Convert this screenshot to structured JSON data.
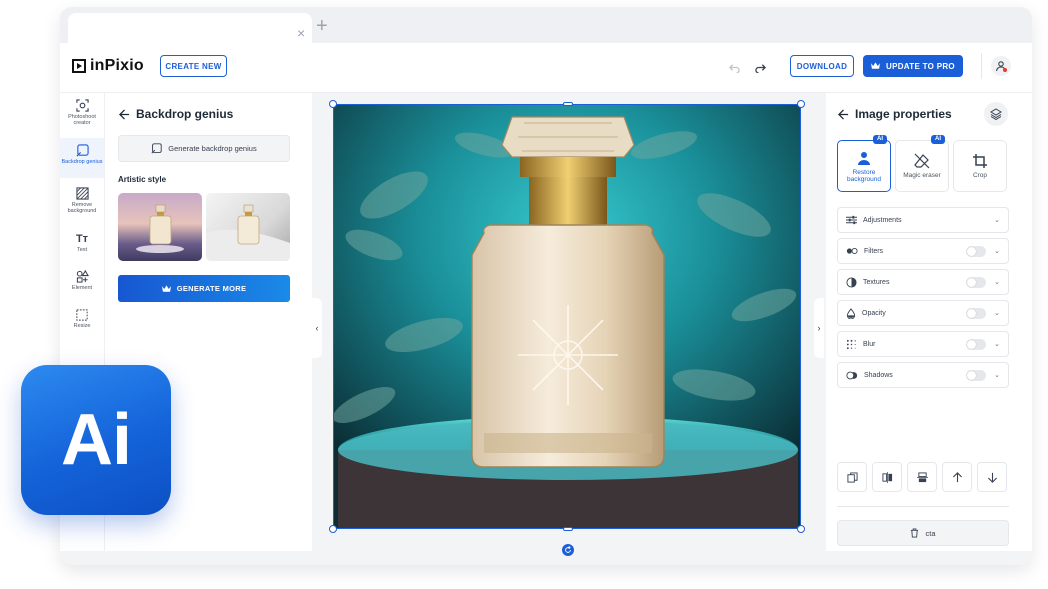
{
  "browser": {
    "tab_close": "×",
    "new_tab": "+"
  },
  "header": {
    "logo_text": "inPixio",
    "create_new": "CREATE NEW",
    "download": "DOWNLOAD",
    "update_pro": "UPDATE TO PRO"
  },
  "toolbar": {
    "items": [
      {
        "label": "Photoshoot creator"
      },
      {
        "label": "Backdrop genius"
      },
      {
        "label": "Remove background"
      },
      {
        "label": "Text"
      },
      {
        "label": "Element"
      },
      {
        "label": "Resize"
      }
    ]
  },
  "left_panel": {
    "title": "Backdrop genius",
    "generate_button": "Generate backdrop genius",
    "section_label": "Artistic style",
    "generate_more": "GENERATE MORE"
  },
  "right_panel": {
    "title": "Image properties",
    "tools": [
      {
        "label": "Restore background",
        "badge": "AI"
      },
      {
        "label": "Magic eraser",
        "badge": "AI"
      },
      {
        "label": "Crop"
      }
    ],
    "properties": [
      {
        "label": "Adjustments"
      },
      {
        "label": "Filters"
      },
      {
        "label": "Textures"
      },
      {
        "label": "Opacity"
      },
      {
        "label": "Blur"
      },
      {
        "label": "Shadows"
      }
    ],
    "cta": "cta"
  },
  "overlay": {
    "ai_text": "Ai"
  },
  "colors": {
    "accent": "#1a5fd8",
    "badge_bg": "#1a5fd8"
  }
}
